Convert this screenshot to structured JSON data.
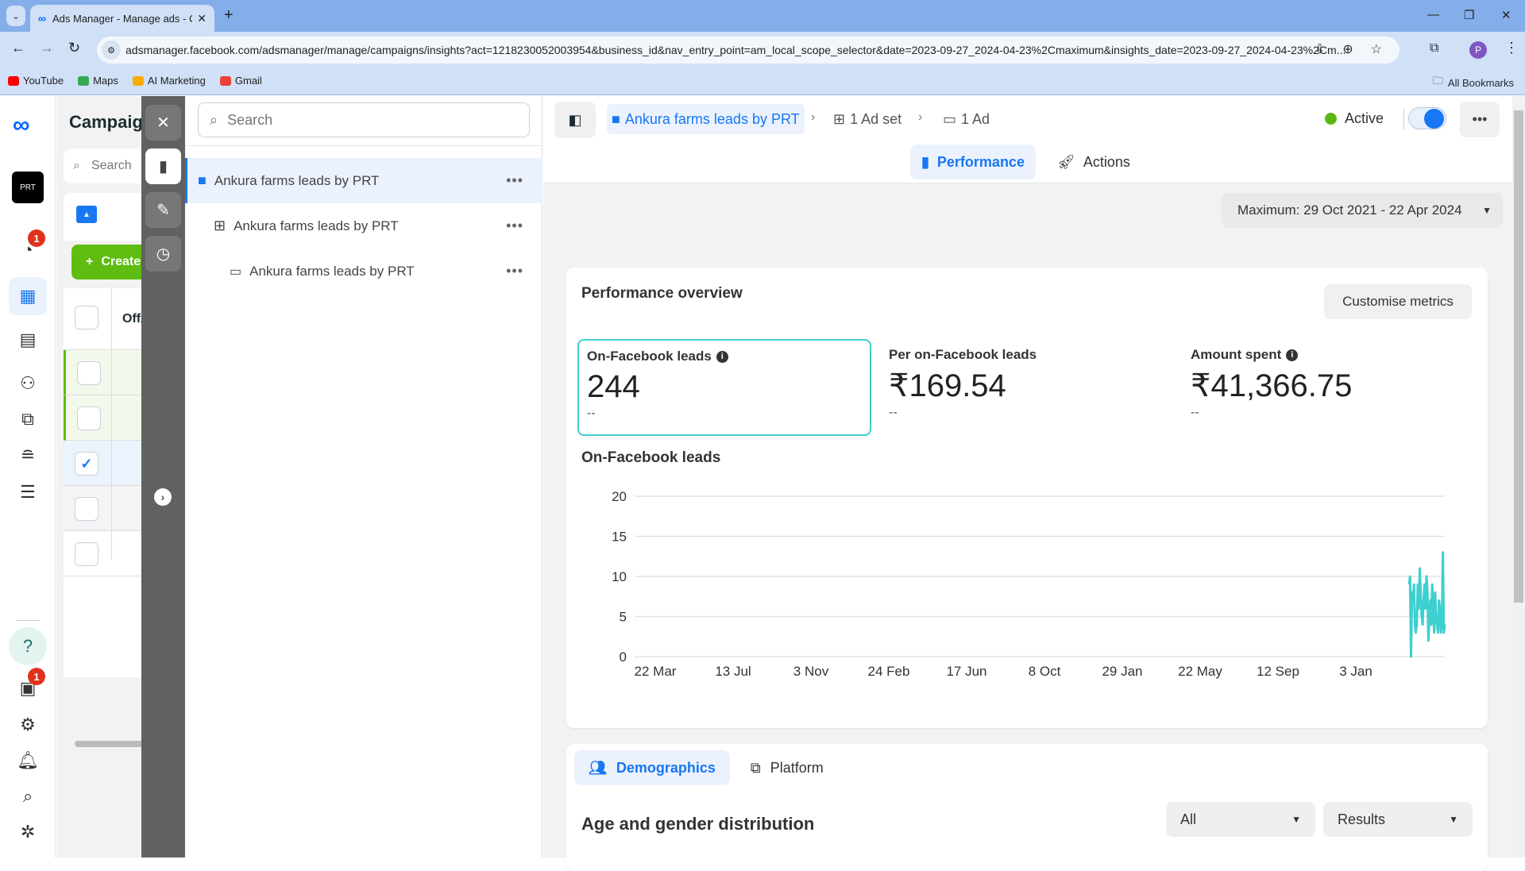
{
  "browser": {
    "tab_title": "Ads Manager - Manage ads - C",
    "url": "adsmanager.facebook.com/adsmanager/manage/campaigns/insights?act=1218230052003954&business_id&nav_entry_point=am_local_scope_selector&date=2023-09-27_2024-04-23%2Cmaximum&insights_date=2023-09-27_2024-04-23%2Cm...",
    "profile_initial": "P",
    "bookmarks": [
      {
        "label": "YouTube",
        "color": "#ff0000"
      },
      {
        "label": "Maps",
        "color": "#34a853"
      },
      {
        "label": "AI Marketing",
        "color": "#f9ab00"
      },
      {
        "label": "Gmail",
        "color": "#ea4335"
      }
    ],
    "all_bookmarks": "All Bookmarks"
  },
  "left_nav": {
    "notification_badge": "1",
    "news_badge": "1",
    "items": [
      "account-overview",
      "campaigns",
      "reports",
      "audiences",
      "creative",
      "billing",
      "all-tools",
      "help",
      "news",
      "settings",
      "notifications",
      "search",
      "bug-report"
    ]
  },
  "campaigns_panel": {
    "title": "Campaigns",
    "search_placeholder": "Search",
    "create_label": "Create",
    "column_header": "Off/On",
    "rows": [
      {
        "checked": false
      },
      {
        "checked": false
      },
      {
        "checked": true
      },
      {
        "checked": false
      },
      {
        "checked": false
      }
    ]
  },
  "tree": {
    "search_placeholder": "Search",
    "items": [
      {
        "level": "campaign",
        "label": "Ankura farms leads by PRT"
      },
      {
        "level": "adset",
        "label": "Ankura farms leads by PRT"
      },
      {
        "level": "ad",
        "label": "Ankura farms leads by PRT"
      }
    ]
  },
  "header": {
    "breadcrumb": {
      "campaign": "Ankura farms leads by PRT",
      "adset": "1 Ad set",
      "ad": "1 Ad"
    },
    "status": "Active",
    "toggle_on": true,
    "tabs": [
      "Performance",
      "Actions"
    ],
    "active_tab": "Performance",
    "date_range": "Maximum: 29 Oct 2021 - 22 Apr 2024"
  },
  "overview": {
    "title": "Performance overview",
    "customise_label": "Customise metrics",
    "metrics": [
      {
        "label": "On-Facebook leads",
        "value": "244",
        "comparison": "--",
        "info": true
      },
      {
        "label": "Per on-Facebook leads",
        "value": "₹169.54",
        "comparison": "--",
        "info": false
      },
      {
        "label": "Amount spent",
        "value": "₹41,366.75",
        "comparison": "--",
        "info": true
      }
    ],
    "chart_title": "On-Facebook leads"
  },
  "chart_data": {
    "type": "line",
    "title": "On-Facebook leads",
    "xlabel": "",
    "ylabel": "",
    "ylim": [
      0,
      20
    ],
    "yticks": [
      0,
      5,
      10,
      15,
      20
    ],
    "xticks": [
      "22 Mar",
      "13 Jul",
      "3 Nov",
      "24 Feb",
      "17 Jun",
      "8 Oct",
      "29 Jan",
      "22 May",
      "12 Sep",
      "3 Jan"
    ],
    "grid": true,
    "color": "#3ecfcf",
    "series": [
      {
        "name": "On-Facebook leads",
        "start_fraction": 0.956,
        "end_fraction": 1.0,
        "values": [
          9,
          10,
          0,
          8,
          7,
          9,
          4,
          3,
          4,
          9,
          6,
          11,
          8,
          5,
          4,
          7,
          9,
          6,
          10,
          8,
          2,
          5,
          7,
          4,
          9,
          6,
          3,
          8,
          5,
          4,
          3,
          7,
          6,
          3,
          4,
          13,
          3,
          4
        ]
      }
    ]
  },
  "breakdown": {
    "tabs": [
      "Demographics",
      "Platform"
    ],
    "active_tab": "Demographics",
    "title": "Age and gender distribution",
    "filter_value": "All",
    "metric_value": "Results"
  }
}
